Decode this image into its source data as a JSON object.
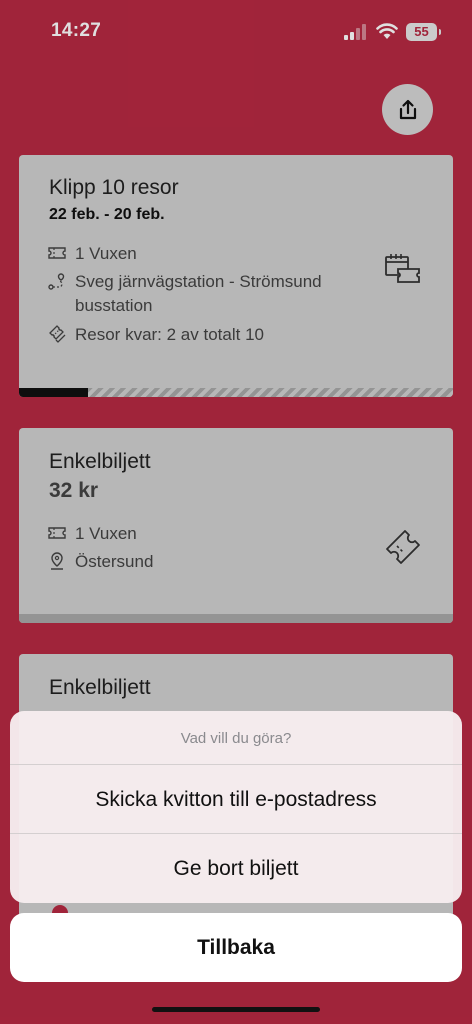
{
  "status_bar": {
    "time": "14:27",
    "battery": "55"
  },
  "tickets": [
    {
      "title": "Klipp 10 resor",
      "dates": "22 feb. - 20 feb.",
      "passengers": "1 Vuxen",
      "route": "Sveg järnvägstation - Strömsund busstation",
      "remaining": "Resor kvar: 2 av totalt 10",
      "progress_fraction": 0.16
    },
    {
      "title": "Enkelbiljett",
      "price": "32 kr",
      "passengers": "1 Vuxen",
      "zone": "Östersund"
    },
    {
      "title": "Enkelbiljett"
    }
  ],
  "action_sheet": {
    "title": "Vad vill du göra?",
    "actions": [
      "Skicka kvitton till e-postadress",
      "Ge bort biljett"
    ],
    "cancel": "Tillbaka"
  },
  "colors": {
    "background": "#b72942",
    "card": "#d1d1d1"
  }
}
